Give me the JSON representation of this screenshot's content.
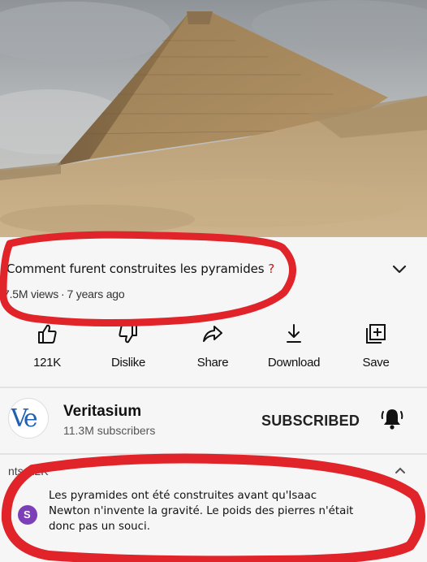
{
  "video": {
    "title": "Comment furent construites les pyramides ",
    "title_q": "?",
    "views": "7.5M views",
    "separator": "·",
    "age": "7 years ago"
  },
  "actions": [
    {
      "icon": "thumbs-up-icon",
      "label": "121K"
    },
    {
      "icon": "thumbs-down-icon",
      "label": "Dislike"
    },
    {
      "icon": "share-icon",
      "label": "Share"
    },
    {
      "icon": "download-icon",
      "label": "Download"
    },
    {
      "icon": "save-playlist-icon",
      "label": "Save"
    }
  ],
  "channel": {
    "logo_text": "Ve",
    "name": "Veritasium",
    "subscribers": "11.3M subscribers",
    "subscribe_state": "SUBSCRIBED"
  },
  "comments": {
    "label_fragment": "nts",
    "count": "12K",
    "avatar_letter": "S",
    "text": "Les pyramides ont été construites avant qu'Isaac Newton n'invente la gravité. Le poids des pierres n'était donc pas un souci."
  },
  "colors": {
    "marker_red": "#e0242a",
    "logo_blue": "#1f5fb4",
    "comment_avatar": "#7c3fb8"
  }
}
